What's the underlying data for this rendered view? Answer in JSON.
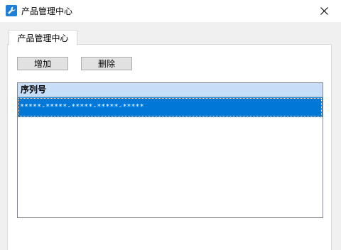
{
  "window": {
    "title": "产品管理中心",
    "icon": "wrench-icon",
    "close_icon": "close-icon"
  },
  "tabs": [
    {
      "label": "产品管理中心",
      "selected": true
    }
  ],
  "toolbar": {
    "add_label": "增加",
    "delete_label": "删除"
  },
  "list": {
    "columns": [
      "序列号"
    ],
    "rows": [
      {
        "serial": "*****-*****-*****-*****-*****",
        "selected": true
      }
    ]
  },
  "colors": {
    "selection": "#0078d7",
    "header": "#c6def7",
    "app_icon": "#1e7fd8"
  }
}
